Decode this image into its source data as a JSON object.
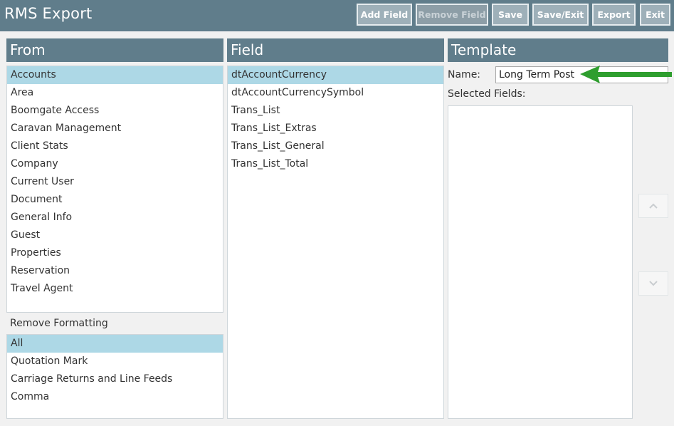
{
  "app": {
    "title": "RMS Export"
  },
  "toolbar": {
    "add_field": "Add Field",
    "remove_field": "Remove Field",
    "save": "Save",
    "save_exit": "Save/Exit",
    "export": "Export",
    "exit": "Exit"
  },
  "from": {
    "header": "From",
    "items": [
      "Accounts",
      "Area",
      "Boomgate Access",
      "Caravan Management",
      "Client Stats",
      "Company",
      "Current User",
      "Document",
      "General Info",
      "Guest",
      "Properties",
      "Reservation",
      "Travel Agent"
    ],
    "selected": "Accounts"
  },
  "remove_formatting": {
    "label": "Remove Formatting",
    "items": [
      "All",
      "Quotation Mark",
      "Carriage Returns and Line Feeds",
      "Comma"
    ],
    "selected": "All"
  },
  "field": {
    "header": "Field",
    "items": [
      "dtAccountCurrency",
      "dtAccountCurrencySymbol",
      "Trans_List",
      "Trans_List_Extras",
      "Trans_List_General",
      "Trans_List_Total"
    ],
    "selected": "dtAccountCurrency"
  },
  "template": {
    "header": "Template",
    "name_label": "Name:",
    "name_value": "Long Term Post",
    "selected_fields_label": "Selected Fields:",
    "selected_fields": []
  },
  "icons": {
    "move_up": "chevron-up-icon",
    "move_down": "chevron-down-icon",
    "annotation": "green-arrow-icon"
  },
  "colors": {
    "header_bg": "#607d8b",
    "button_bg": "#9eb0b9",
    "selected_row": "#add8e6",
    "annotation_arrow": "#2e9e2e"
  }
}
